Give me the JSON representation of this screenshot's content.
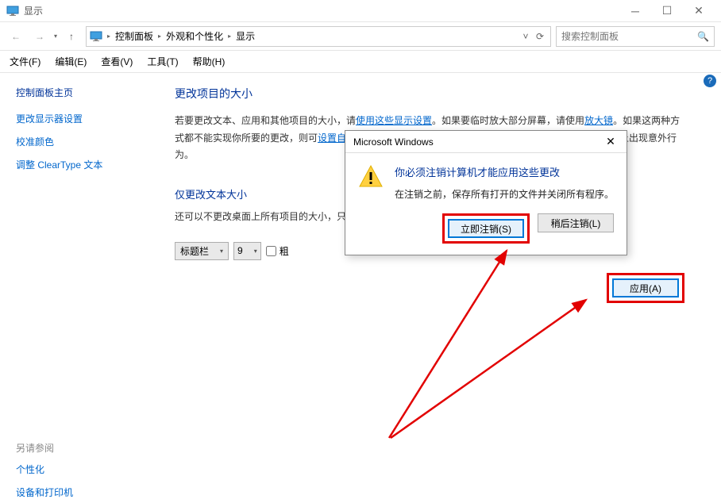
{
  "titlebar": {
    "title": "显示"
  },
  "nav": {
    "breadcrumb": {
      "root": "控制面板",
      "l2": "外观和个性化",
      "l3": "显示"
    },
    "search_placeholder": "搜索控制面板"
  },
  "menu": {
    "file": "文件(F)",
    "edit": "编辑(E)",
    "view": "查看(V)",
    "tools": "工具(T)",
    "help": "帮助(H)"
  },
  "sidebar": {
    "home": "控制面板主页",
    "l1": "更改显示器设置",
    "l2": "校准颜色",
    "l3": "调整 ClearType 文本",
    "see_also": "另请参阅",
    "sa1": "个性化",
    "sa2": "设备和打印机"
  },
  "main": {
    "h1": "更改项目的大小",
    "p1_a": "若要更改文本、应用和其他项目的大小，请",
    "p1_link1": "使用这些显示设置",
    "p1_b": "。如果要临时放大部分屏幕，请使用",
    "p1_link2": "放大镜",
    "p1_c": "。如果这两种方式都不能实现你所要的更改，则可",
    "p1_link3": "设置自定义缩放级别",
    "p1_d": "(不建议)。设置自定义级别可能会导致在某些显示器上出现意外行为。",
    "h2": "仅更改文本大小",
    "p2": "还可以不更改桌面上所有项目的大小，只",
    "combo1": "标题栏",
    "combo2": "9",
    "bold_label": "粗",
    "apply": "应用(A)"
  },
  "dialog": {
    "title": "Microsoft Windows",
    "head": "你必须注销计算机才能应用这些更改",
    "sub": "在注销之前，保存所有打开的文件并关闭所有程序。",
    "btn1": "立即注销(S)",
    "btn2": "稍后注销(L)"
  },
  "help_icon": "?"
}
